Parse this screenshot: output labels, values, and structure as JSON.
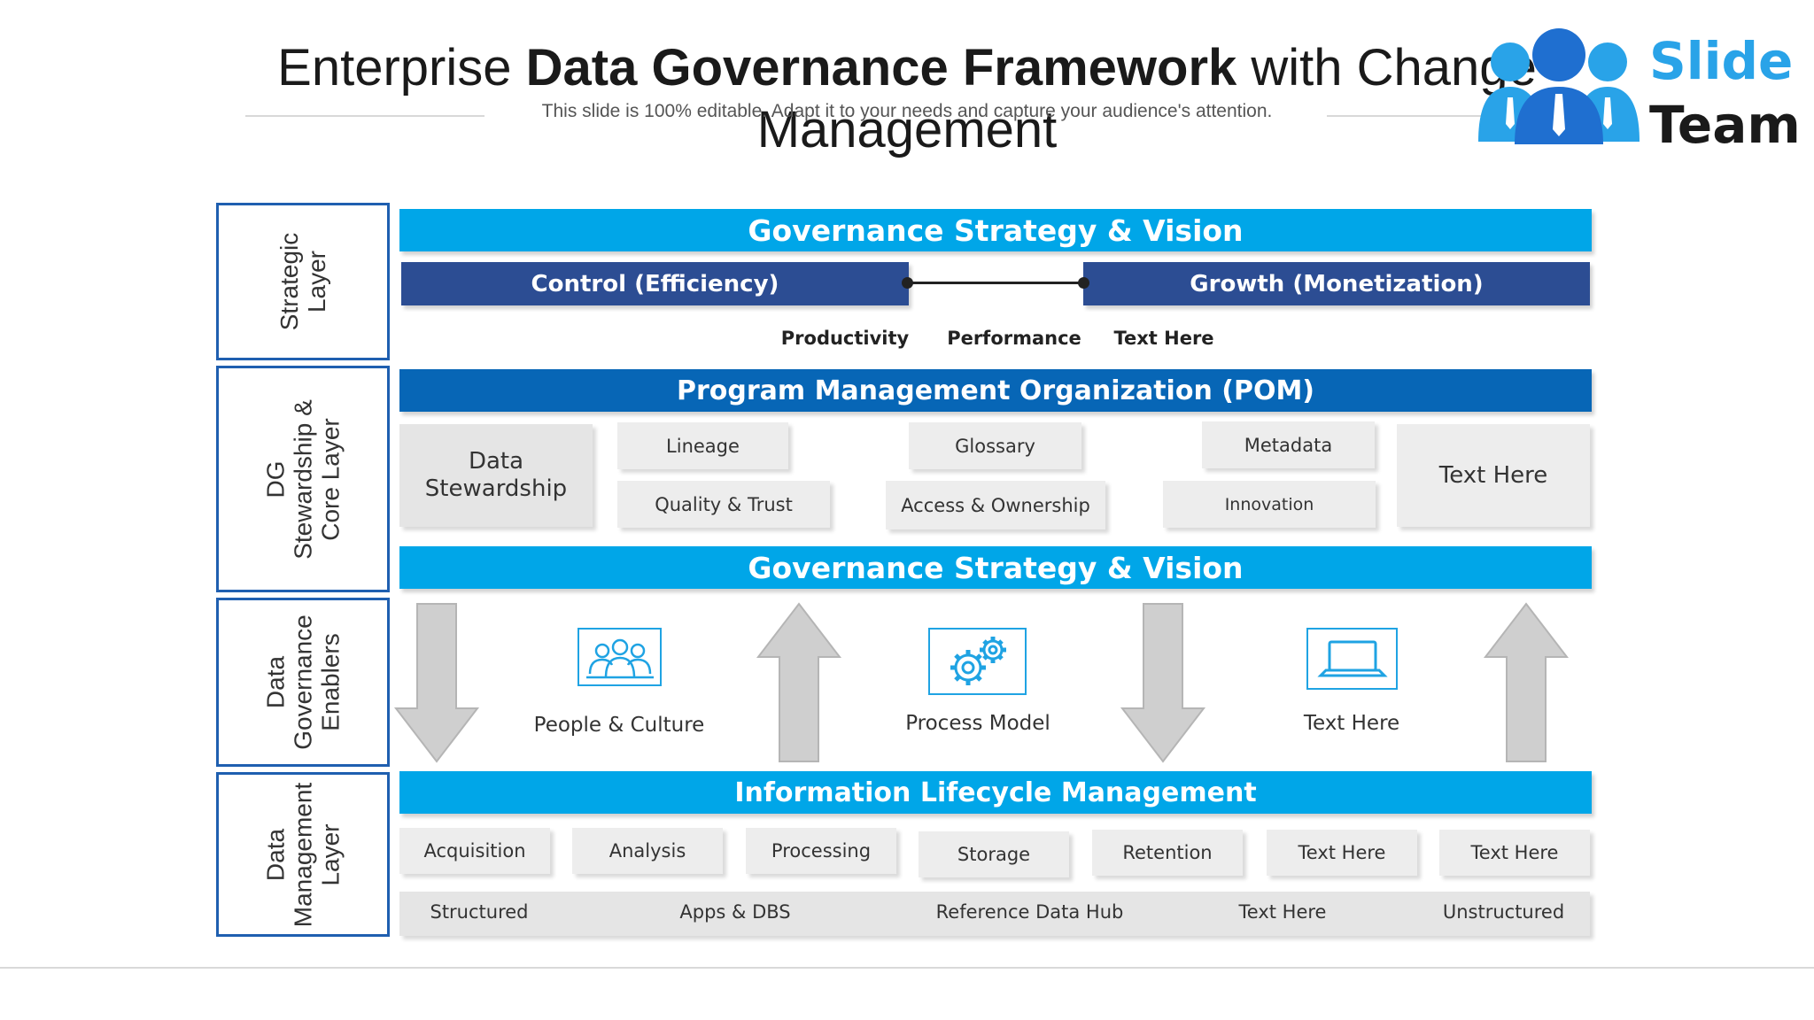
{
  "header": {
    "title_part1": "Enterprise ",
    "title_part2": "Data Governance Framework",
    "title_part3": " with Change",
    "title_line2": "Management",
    "subtitle": "This slide is 100% editable. Adapt it to your needs and capture your audience's attention."
  },
  "logo": {
    "word1": "Slide",
    "word2": "Team",
    "icon": "team-people-icon"
  },
  "layers": [
    {
      "label": "Strategic\nLayer"
    },
    {
      "label": "DG\nStewardship &\nCore Layer"
    },
    {
      "label": "Data\nGovernance\nEnablers"
    },
    {
      "label": "Data\nManagement\nLayer"
    }
  ],
  "strategic": {
    "top_bar": "Governance Strategy & Vision",
    "control": "Control (Efficiency)",
    "growth": "Growth (Monetization)",
    "metrics": [
      "Productivity",
      "Performance",
      "Text Here"
    ]
  },
  "stewardship": {
    "pom_bar": "Program Management Organization (POM)",
    "left_box": "Data\nStewardship",
    "right_box": "Text Here",
    "items": [
      "Lineage",
      "Glossary",
      "Metadata",
      "Quality & Trust",
      "Access & Ownership",
      "Innovation"
    ],
    "bottom_bar": "Governance Strategy & Vision"
  },
  "enablers": {
    "items": [
      {
        "label": "People & Culture",
        "icon": "people-group-icon"
      },
      {
        "label": "Process Model",
        "icon": "gears-icon"
      },
      {
        "label": "Text Here",
        "icon": "laptop-icon"
      }
    ]
  },
  "management": {
    "bar": "Information Lifecycle Management",
    "row1": [
      "Acquisition",
      "Analysis",
      "Processing",
      "Storage",
      "Retention",
      "Text Here",
      "Text Here"
    ],
    "row2": [
      "Structured",
      "Apps & DBS",
      "Reference Data Hub",
      "Text Here",
      "Unstructured"
    ]
  },
  "colors": {
    "light_blue": "#00a6e8",
    "blue": "#0766b6",
    "navy": "#2c4d93",
    "border_blue": "#1f5fb0",
    "gray_box": "#e5e5e5",
    "arrow_gray": "#cfcfcf"
  }
}
